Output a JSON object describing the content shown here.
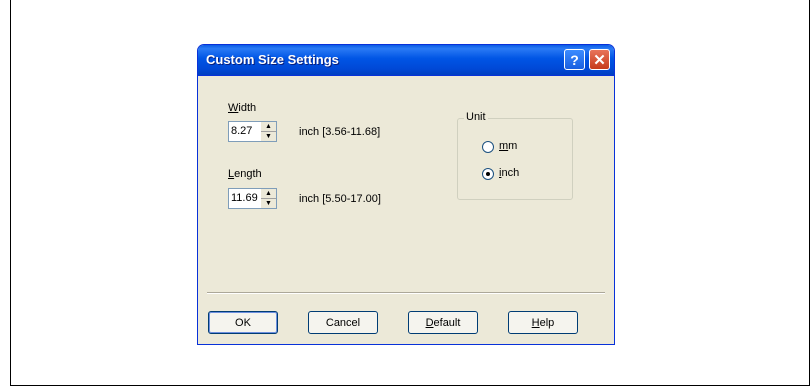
{
  "dialog": {
    "title": "Custom Size Settings",
    "help_glyph": "?",
    "close_glyph": "✕"
  },
  "width": {
    "label_first": "W",
    "label_rest": "idth",
    "value": "8.27",
    "range": "inch [3.56-11.68]"
  },
  "length": {
    "label_first": "L",
    "label_rest": "ength",
    "value": "11.69",
    "range": "inch [5.50-17.00]"
  },
  "unit": {
    "title": "Unit",
    "options": [
      {
        "first": "m",
        "rest": "m",
        "selected": false
      },
      {
        "first": "i",
        "rest": "nch",
        "selected": true
      }
    ]
  },
  "buttons": {
    "ok": "OK",
    "cancel": "Cancel",
    "default_first": "D",
    "default_rest": "efault",
    "help_first": "H",
    "help_rest": "elp"
  },
  "colors": {
    "titlebar": "#0055e5",
    "dialog_bg": "#ece9d8",
    "close_red": "#c63a1b"
  }
}
